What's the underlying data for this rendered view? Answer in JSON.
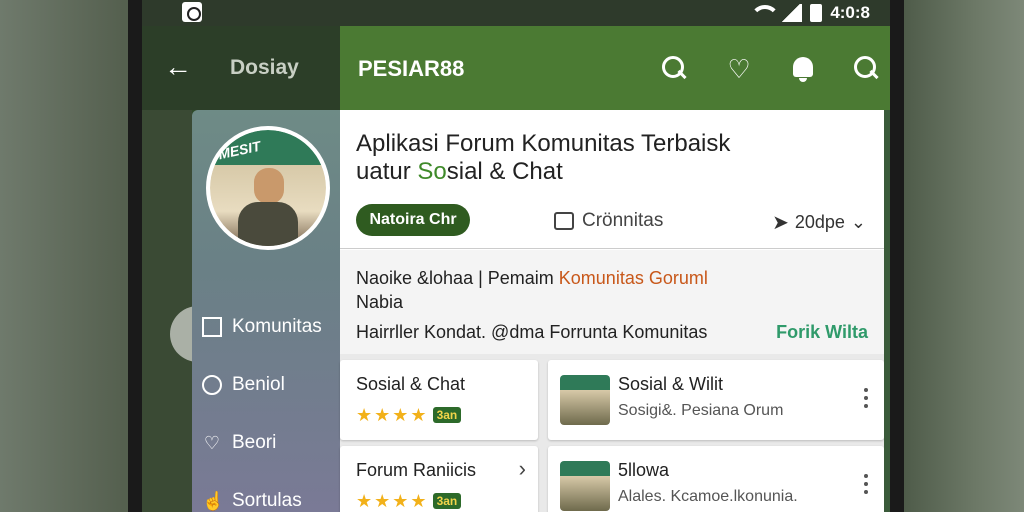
{
  "statusbar": {
    "time": "4:0:8"
  },
  "back_bar": {
    "title": "Dosiay"
  },
  "appbar": {
    "title": "PESIAR88",
    "icons": [
      "search-icon",
      "heart-icon",
      "bell-icon",
      "search-icon"
    ]
  },
  "drawer": {
    "avatar_banner": "MESIT",
    "items": [
      {
        "label": "Komunitas",
        "icon": "square-icon"
      },
      {
        "label": "Beniol",
        "icon": "circle-icon"
      },
      {
        "label": "Beori",
        "icon": "heart-icon"
      },
      {
        "label": "Sortulas",
        "icon": "hand-icon"
      }
    ]
  },
  "main": {
    "headline_line1": "Aplikasi Forum Komunitas  Terbaisk",
    "headline_line2_pre": "uatur ",
    "headline_line2_green": "So",
    "headline_line2_post": "sial & Chat",
    "chat_button": "Natoira Chr",
    "komunitas_link": "Crönnitas",
    "share_link": "20dpe",
    "notice": {
      "line1_pre": "Naoike &lohaa | Pemaim ",
      "line1_orange": "Komunitas Goruml",
      "line2": "Nabia",
      "line3": "Hairrller Kondat. @dma Forrunta Komunitas",
      "action": "Forik Wilta"
    },
    "tiles": [
      {
        "title": "Sosial & Chat",
        "badge": "3an"
      },
      {
        "title": "Sosial & Wilit",
        "subtitle": "Sosigi&. Pesiana Orum"
      },
      {
        "title": "Forum Raniicis",
        "badge": "3an"
      },
      {
        "title": "5llowa",
        "subtitle": "Alales. Kcamoe.lkonunia."
      }
    ]
  },
  "colors": {
    "appbar": "#4b7a33",
    "chat_button": "#2f5b20",
    "accent_orange": "#c8581a",
    "accent_teal": "#2f9a6a",
    "star": "#f2b11a"
  }
}
